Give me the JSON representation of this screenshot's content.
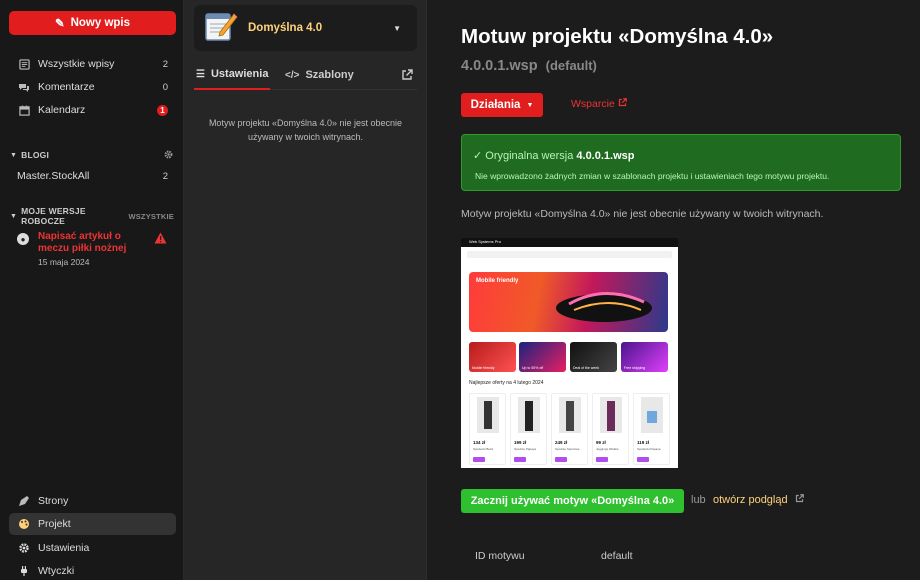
{
  "sidebar": {
    "new_post_label": "Nowy wpis",
    "nav": [
      {
        "label": "Wszystkie wpisy",
        "count": "2"
      },
      {
        "label": "Komentarze",
        "count": "0"
      },
      {
        "label": "Kalendarz",
        "count": "1"
      }
    ],
    "blogs_heading": "BLOGI",
    "blog_item": {
      "label": "Master.StockAll",
      "count": "2"
    },
    "drafts_heading": "MOJE WERSJE ROBOCZE",
    "drafts_all": "WSZYSTKIE",
    "draft": {
      "title": "Napisać artykuł o meczu piłki nożnej",
      "date": "15 maja 2024"
    },
    "bottom": [
      {
        "label": "Strony"
      },
      {
        "label": "Projekt"
      },
      {
        "label": "Ustawienia"
      },
      {
        "label": "Wtyczki"
      }
    ]
  },
  "middle": {
    "project_name": "Domyślna 4.0",
    "tab_settings": "Ustawienia",
    "tab_templates": "Szablony",
    "message": "Motyw projektu «Domyślna 4.0» nie jest obecnie używany w twoich witrynach."
  },
  "main": {
    "title": "Motuw projektu «Domyślna 4.0»",
    "version": "4.0.0.1.wsp",
    "version_default": "(default)",
    "actions_label": "Działania",
    "support_label": "Wsparcie",
    "ok_title_prefix": "Oryginalna wersja",
    "ok_version": "4.0.0.1.wsp",
    "ok_sub": "Nie wprowadzono żadnych zmian w szablonach projektu i ustawieniach tego motywu projektu.",
    "description": "Motyw projektu «Domyślna 4.0» nie jest obecnie używany w twoich witrynach.",
    "start_label": "Zacznij używać motyw «Domyślna 4.0»",
    "or_label": "lub",
    "preview_link": "otwórz podgląd",
    "meta_key": "ID motywu",
    "meta_value": "default",
    "preview": {
      "brand": "Web Systems Pro",
      "hero_title": "Mobile friendly",
      "offers_heading": "Najlepsze oferty na 4 lutego 2024",
      "tiles": [
        "Mobile friendly",
        "Up to 50% off",
        "Deal of the week",
        "Free shipping"
      ],
      "products": [
        {
          "price": "134 zł",
          "name": "Spodenki Beża"
        },
        {
          "price": "199 zł",
          "name": "Spodnie Papaya"
        },
        {
          "price": "249 zł",
          "name": "Spodnie Sportowe"
        },
        {
          "price": "99 zł",
          "name": "Jeggings Wielkie"
        },
        {
          "price": "119 zł",
          "name": "Spodenki Papaya"
        }
      ]
    }
  },
  "colors": {
    "accent": "#e11d1d",
    "success": "#2ec02e",
    "link_yellow": "#ffd27a"
  }
}
